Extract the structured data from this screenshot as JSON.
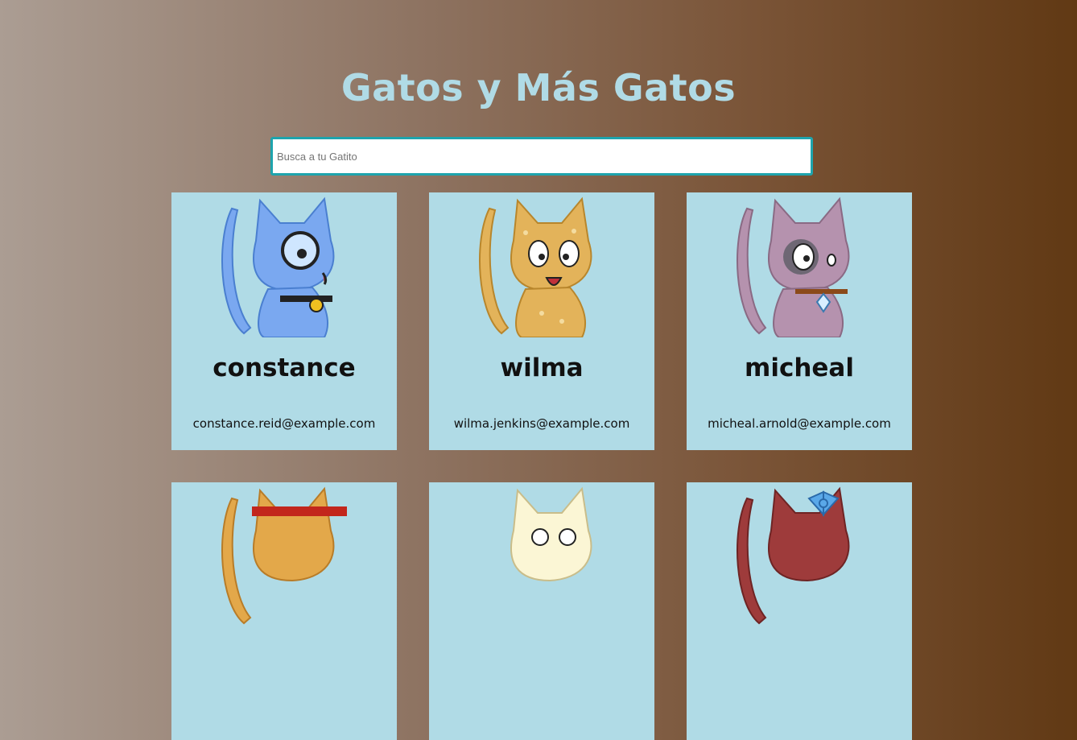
{
  "header": {
    "title": "Gatos y Más Gatos"
  },
  "search": {
    "placeholder": "Busca a tu Gatito",
    "value": ""
  },
  "colors": {
    "card": "#b0dbe6",
    "title": "#b0dbe6",
    "search_border": "#1ea4ad"
  },
  "cards": [
    {
      "name": "constance",
      "email": "constance.reid@example.com",
      "icon": "blue-detective-cat",
      "fur": "#7aa8f0"
    },
    {
      "name": "wilma",
      "email": "wilma.jenkins@example.com",
      "icon": "spotted-yellow-cat",
      "fur": "#e3b35a"
    },
    {
      "name": "micheal",
      "email": "micheal.arnold@example.com",
      "icon": "pink-pirate-cat",
      "fur": "#b592ae"
    },
    {
      "name": "",
      "email": "",
      "icon": "orange-bandana-cat",
      "fur": "#e3a84a"
    },
    {
      "name": "",
      "email": "",
      "icon": "cream-cat",
      "fur": "#fbf6d5"
    },
    {
      "name": "",
      "email": "",
      "icon": "red-bow-cat",
      "fur": "#9e3b3b"
    }
  ]
}
